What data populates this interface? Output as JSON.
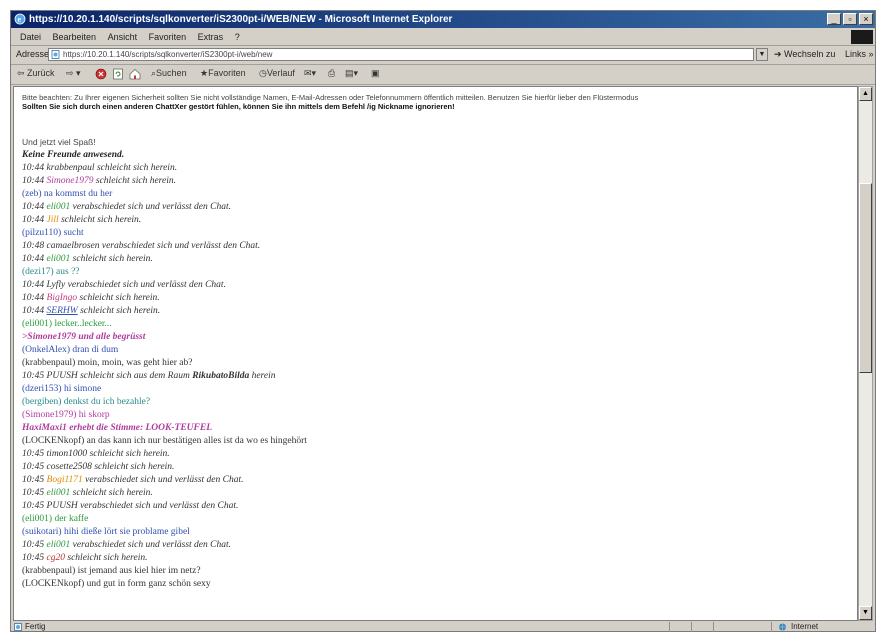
{
  "window": {
    "title": "https://10.20.1.140/scripts/sqlkonverter/iS2300pt-i/WEB/NEW - Microsoft Internet Explorer",
    "controls": {
      "minimize": "_",
      "maximize": "▫",
      "close": "×"
    }
  },
  "menu": [
    "Datei",
    "Bearbeiten",
    "Ansicht",
    "Favoriten",
    "Extras",
    "?"
  ],
  "address": {
    "label": "Adresse",
    "url": "https://10.20.1.140/scripts/sqlkonverter/iS2300pt-i/web/new",
    "go_label": "Wechseln zu",
    "links_label": "Links »"
  },
  "toolbar": {
    "back": "Zurück",
    "search": "Suchen",
    "favorites": "Favoriten",
    "history": "Verlauf"
  },
  "intro": {
    "line1": "Bitte beachten: Zu Ihrer eigenen Sicherheit sollten Sie nicht vollständige Namen, E-Mail-Adressen oder Telefonnummern öffentlich mitteilen. Benutzen Sie hierfür lieber den Flüstermodus",
    "line2": "Sollten Sie sich durch einen anderen ChattXer gestört fühlen, können Sie ihn mittels dem Befehl /ig Nickname ignorieren!"
  },
  "chat": {
    "l00": {
      "text": "Und jetzt viel Spaß!"
    },
    "l01": {
      "text": "Keine Freunde anwesend."
    },
    "l02": {
      "a": "10:44 ",
      "b": "krabbenpaul",
      "c": " schleicht sich herein."
    },
    "l03": {
      "a": "10:44 ",
      "b": "Simone1979",
      "c": " schleicht sich herein."
    },
    "l04": {
      "a": "(zeb)",
      "b": " na kommst du her"
    },
    "l05": {
      "a": "10:44 ",
      "b": "eli001",
      "c": " verabschiedet sich und verlässt den Chat."
    },
    "l06": {
      "a": "10:44 ",
      "b": "Jill",
      "c": " schleicht sich herein."
    },
    "l07": {
      "a": "(pilzu110)",
      "b": " sucht"
    },
    "l08": {
      "a": "10:48 ",
      "b": "camaelbrosen",
      "c": " verabschiedet sich und verlässt den Chat."
    },
    "l09": {
      "a": "10:44 ",
      "b": "eli001",
      "c": " schleicht sich herein."
    },
    "l10": {
      "a": "(dezi17)",
      "b": " aus ??"
    },
    "l11": {
      "a": "10:44 ",
      "b": "Lyfly",
      "c": " verabschiedet sich und verlässt den Chat."
    },
    "l12": {
      "a": "10:44 ",
      "b": "BigIngo",
      "c": " schleicht sich herein."
    },
    "l13": {
      "a": "10:44 ",
      "b": "SERHW",
      "c": " schleicht sich herein."
    },
    "l14": {
      "a": "(eli001)",
      "b": " lecker..lecker..."
    },
    "l15": {
      "text": ">Simone1979 und alle begrüsst"
    },
    "l16": {
      "a": "(OnkelAlex)",
      "b": " dran di dum"
    },
    "l17": {
      "a": "(krabbenpaul)",
      "b": " moin, moin, was geht hier ab?"
    },
    "l18": {
      "a": "10:45 ",
      "b": "PUUSH",
      "c": " schleicht sich aus dem Raum ",
      "d": "RikubatoBilda",
      "e": " herein"
    },
    "l19": {
      "a": "(dzeri153)",
      "b": " hi simone"
    },
    "l20": {
      "a": "(bergiben)",
      "b": " denkst du ich bezahle?"
    },
    "l21": {
      "a": "(Simone1979)",
      "b": " hi skorp"
    },
    "l22": {
      "text": "HaxiMaxi1 erhebt die Stimme: LOOK-TEUFEL"
    },
    "l23": {
      "a": "(LOCKENkopf)",
      "b": " an das kann ich nur bestätigen alles ist da wo es hingehört"
    },
    "l24": {
      "a": "10:45 ",
      "b": "timon1000",
      "c": " schleicht sich herein."
    },
    "l25": {
      "a": "10:45 ",
      "b": "cosette2508",
      "c": " schleicht sich herein."
    },
    "l26": {
      "a": "10:45 ",
      "b": "Bogi1171",
      "c": " verabschiedet sich und verlässt den Chat."
    },
    "l27": {
      "a": "10:45 ",
      "b": "eli001",
      "c": " schleicht sich herein."
    },
    "l28": {
      "a": "10:45 ",
      "b": "PUUSH",
      "c": " verabschiedet sich und verlässt den Chat."
    },
    "l29": {
      "a": "(eli001)",
      "b": " der kaffe"
    },
    "l30": {
      "a": "(suikotari)",
      "b": " hihi dieße lört sie problame gibel"
    },
    "l31": {
      "a": "10:45 ",
      "b": "eli001",
      "c": " verabschiedet sich und verlässt den Chat."
    },
    "l32": {
      "a": "10:45 ",
      "b": "cg20",
      "c": " schleicht sich herein."
    },
    "l33": {
      "a": "(krabbenpaul)",
      "b": " ist jemand aus kiel hier im netz?"
    },
    "l34": {
      "a": "(LOCKENkopf)",
      "b": " und gut in form ganz schön sexy"
    }
  },
  "status": {
    "text": "Fertig",
    "zone": "Internet"
  },
  "colors": {
    "title_start": "#0a246a",
    "title_end": "#3a6ea5",
    "purple_nick": "#b03a9e",
    "green_nick": "#2a9a3a",
    "blue_nick": "#3050b0",
    "orange_nick": "#e08a00",
    "pink_nick": "#c04080",
    "red_nick": "#c03030",
    "teal_text": "#2a8a88"
  }
}
